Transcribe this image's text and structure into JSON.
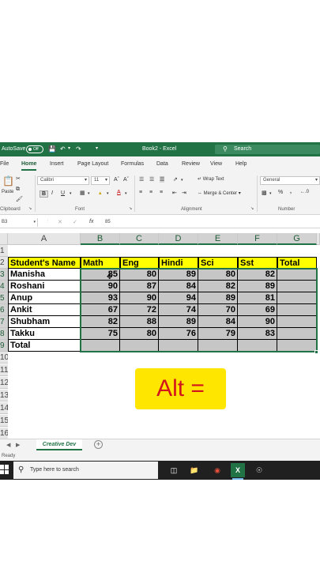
{
  "titlebar": {
    "autosave_label": "AutoSave",
    "autosave_state": "Off",
    "doc_title": "Book2 - Excel",
    "search_label": "Search"
  },
  "tabs": [
    "File",
    "Home",
    "Insert",
    "Page Layout",
    "Formulas",
    "Data",
    "Review",
    "View",
    "Help"
  ],
  "active_tab": "Home",
  "ribbon": {
    "paste_label": "Paste",
    "font_name": "Calibri",
    "font_size": "11",
    "wrap_text": "Wrap Text",
    "merge_center": "Merge & Center",
    "number_format": "General",
    "group_clipboard": "Clipboard",
    "group_font": "Font",
    "group_alignment": "Alignment",
    "group_number": "Number"
  },
  "formula_bar": {
    "name_box": "B3",
    "fx": "fx",
    "value": "85"
  },
  "columns": [
    "A",
    "B",
    "C",
    "D",
    "E",
    "F",
    "G"
  ],
  "rows": [
    "1",
    "2",
    "3",
    "4",
    "5",
    "6",
    "7",
    "8",
    "9",
    "10",
    "11",
    "12",
    "13",
    "14",
    "15",
    "16"
  ],
  "table": {
    "headers": [
      "Student's Name",
      "Math",
      "Eng",
      "Hindi",
      "Sci",
      "Sst",
      "Total"
    ],
    "rows": [
      {
        "name": "Manisha",
        "values": [
          "85",
          "80",
          "89",
          "80",
          "82"
        ]
      },
      {
        "name": "Roshani",
        "values": [
          "90",
          "87",
          "84",
          "82",
          "89"
        ]
      },
      {
        "name": "Anup",
        "values": [
          "93",
          "90",
          "94",
          "89",
          "81"
        ]
      },
      {
        "name": "Ankit",
        "values": [
          "67",
          "72",
          "74",
          "70",
          "69"
        ]
      },
      {
        "name": "Shubham",
        "values": [
          "82",
          "88",
          "89",
          "84",
          "90"
        ]
      },
      {
        "name": "Takku",
        "values": [
          "75",
          "80",
          "76",
          "79",
          "83"
        ]
      }
    ],
    "total_label": "Total"
  },
  "overlay_text": "Alt  =",
  "sheet_tab": "Creative Dev",
  "status_text": "Ready",
  "taskbar": {
    "search_placeholder": "Type here to search"
  },
  "colors": {
    "excel_green": "#217346",
    "header_yellow": "#ffff00",
    "selection_gray": "#c6c6c6",
    "overlay_yellow": "#ffe600",
    "overlay_text_red": "#d2141c"
  }
}
